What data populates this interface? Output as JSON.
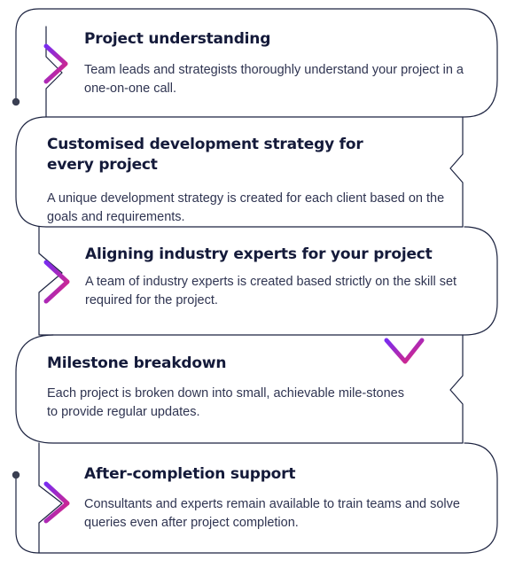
{
  "steps": [
    {
      "title": "Project understanding",
      "description": "Team leads and strategists thoroughly understand your project in a one-on-one call."
    },
    {
      "title": "Customised development strategy for every project",
      "description": "A unique development strategy is created for each client based on the goals and requirements."
    },
    {
      "title": "Aligning industry experts for your project",
      "description": "A team of industry experts is created based strictly on the skill set required for the project."
    },
    {
      "title": "Milestone breakdown",
      "description": "Each project is broken down into small, achievable mile-stones to provide regular updates."
    },
    {
      "title": "After-completion support",
      "description": "Consultants and experts remain available to train teams and solve queries even after project completion."
    }
  ],
  "colors": {
    "outline": "#1c2340",
    "accent_start": "#e0267a",
    "accent_end": "#7a2cf0",
    "title": "#141a3a",
    "text": "#2f3451"
  }
}
